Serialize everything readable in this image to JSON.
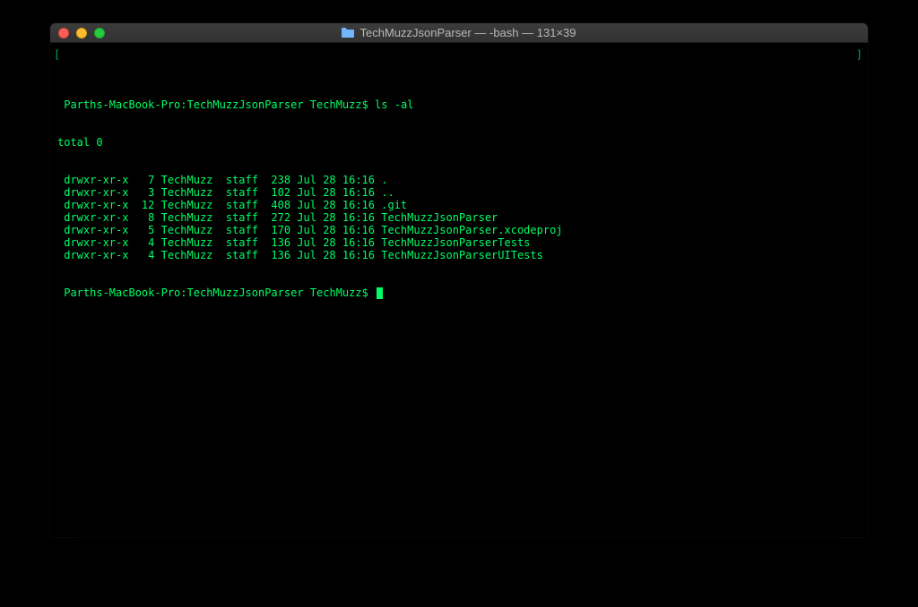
{
  "titlebar": {
    "folder_name": "TechMuzzJsonParser",
    "process": "-bash",
    "dimensions": "131×39"
  },
  "terminal": {
    "prompt_host": "Parths-MacBook-Pro",
    "prompt_dir": "TechMuzzJsonParser",
    "prompt_user": "TechMuzz",
    "command": "ls -al",
    "total_line": "total 0",
    "listing": [
      {
        "perms": "drwxr-xr-x",
        "links": "7",
        "owner": "TechMuzz",
        "group": "staff",
        "size": "238",
        "date": "Jul 28 16:16",
        "name": "."
      },
      {
        "perms": "drwxr-xr-x",
        "links": "3",
        "owner": "TechMuzz",
        "group": "staff",
        "size": "102",
        "date": "Jul 28 16:16",
        "name": ".."
      },
      {
        "perms": "drwxr-xr-x",
        "links": "12",
        "owner": "TechMuzz",
        "group": "staff",
        "size": "408",
        "date": "Jul 28 16:16",
        "name": ".git"
      },
      {
        "perms": "drwxr-xr-x",
        "links": "8",
        "owner": "TechMuzz",
        "group": "staff",
        "size": "272",
        "date": "Jul 28 16:16",
        "name": "TechMuzzJsonParser"
      },
      {
        "perms": "drwxr-xr-x",
        "links": "5",
        "owner": "TechMuzz",
        "group": "staff",
        "size": "170",
        "date": "Jul 28 16:16",
        "name": "TechMuzzJsonParser.xcodeproj"
      },
      {
        "perms": "drwxr-xr-x",
        "links": "4",
        "owner": "TechMuzz",
        "group": "staff",
        "size": "136",
        "date": "Jul 28 16:16",
        "name": "TechMuzzJsonParserTests"
      },
      {
        "perms": "drwxr-xr-x",
        "links": "4",
        "owner": "TechMuzz",
        "group": "staff",
        "size": "136",
        "date": "Jul 28 16:16",
        "name": "TechMuzzJsonParserUITests"
      }
    ]
  },
  "colors": {
    "terminal_text": "#00ff66",
    "terminal_bg": "#000000"
  }
}
